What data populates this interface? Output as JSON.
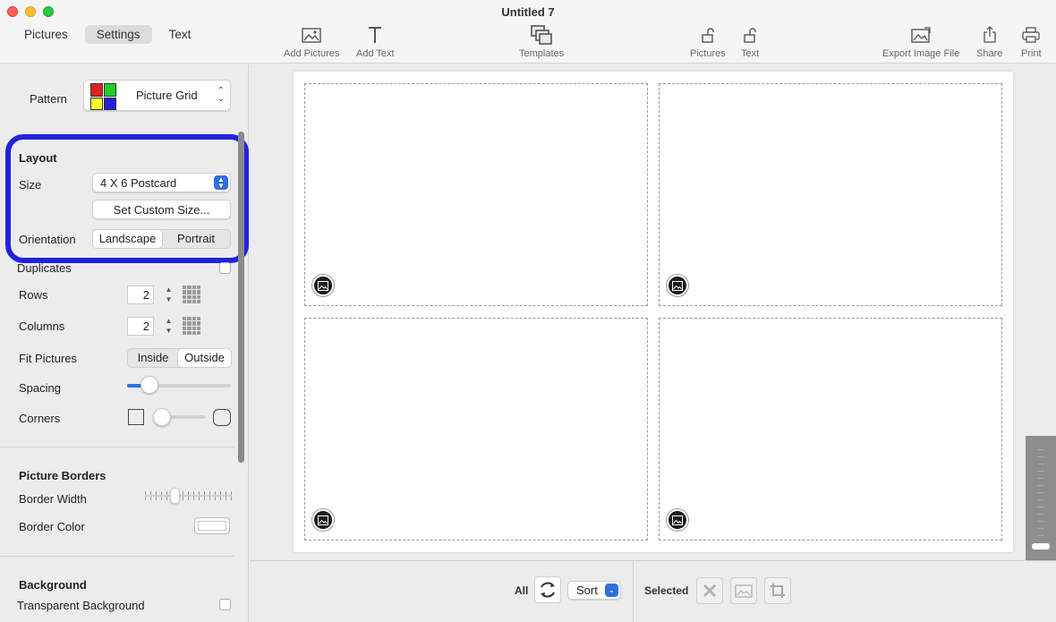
{
  "window": {
    "title": "Untitled 7"
  },
  "tabs": [
    {
      "label": "Pictures",
      "active": false
    },
    {
      "label": "Settings",
      "active": true
    },
    {
      "label": "Text",
      "active": false
    }
  ],
  "toolbar": {
    "add_pictures": "Add Pictures",
    "add_text": "Add Text",
    "templates": "Templates",
    "lock_pictures": "Pictures",
    "lock_text": "Text",
    "export": "Export Image File",
    "share": "Share",
    "print": "Print"
  },
  "sidebar": {
    "pattern_label": "Pattern",
    "pattern_value": "Picture Grid",
    "pattern_colors": [
      "#e02020",
      "#22cc22",
      "#ffff33",
      "#2222dd"
    ],
    "layout_heading": "Layout",
    "size_label": "Size",
    "size_value": "4 X 6 Postcard",
    "custom_size_button": "Set Custom Size...",
    "orientation_label": "Orientation",
    "orientation_options": [
      "Landscape",
      "Portrait"
    ],
    "orientation_selected": "Landscape",
    "duplicates_label": "Duplicates",
    "rows_label": "Rows",
    "rows_value": "2",
    "columns_label": "Columns",
    "columns_value": "2",
    "fit_label": "Fit Pictures",
    "fit_options": [
      "Inside",
      "Outside"
    ],
    "fit_selected": "Outside",
    "spacing_label": "Spacing",
    "corners_label": "Corners",
    "borders_heading": "Picture Borders",
    "border_width_label": "Border Width",
    "border_color_label": "Border Color",
    "background_heading": "Background",
    "transparent_label": "Transparent Background"
  },
  "bottom": {
    "all_label": "All",
    "sort_label": "Sort",
    "selected_label": "Selected"
  },
  "colors": {
    "highlight": "#2222dd",
    "accent": "#2f6fe0"
  }
}
